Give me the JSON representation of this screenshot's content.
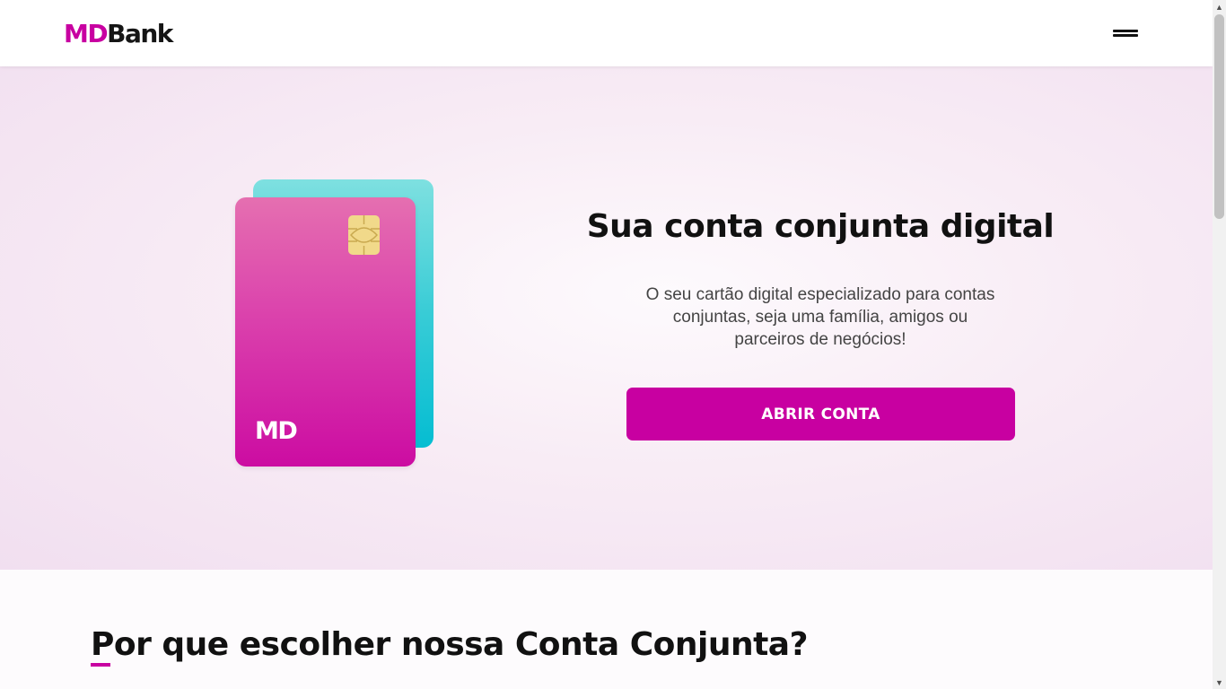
{
  "header": {
    "logo_md": "MD",
    "logo_bank": "Bank",
    "menu_icon": "hamburger-menu-icon"
  },
  "hero": {
    "title": "Sua conta conjunta digital",
    "description": "O seu cartão digital especializado para contas conjuntas, seja uma família, amigos ou parceiros de negócios!",
    "cta_label": "ABRIR CONTA",
    "card_logo": "MD",
    "chip_icon": "card-chip-icon"
  },
  "section": {
    "title": "Por que escolher nossa Conta Conjunta?"
  },
  "colors": {
    "brand": "#c800a1",
    "card_front": "#cc0ca2",
    "card_back": "#05bdd2",
    "hero_bg": "#f1dff0"
  },
  "scrollbar": {
    "up_icon": "scroll-up-arrow-icon",
    "down_icon": "scroll-down-arrow-icon"
  }
}
